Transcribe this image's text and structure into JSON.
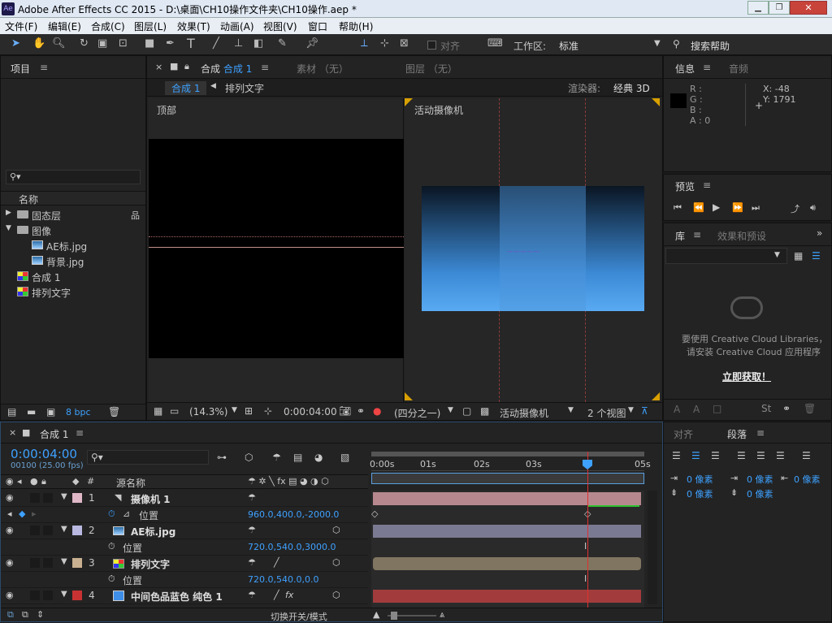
{
  "window": {
    "title": "Adobe After Effects CC 2015 - D:\\桌面\\CH10操作文件夹\\CH10操作.aep *",
    "app_icon": "Ae"
  },
  "menu": [
    "文件(F)",
    "编辑(E)",
    "合成(C)",
    "图层(L)",
    "效果(T)",
    "动画(A)",
    "视图(V)",
    "窗口",
    "帮助(H)"
  ],
  "toolbar": {
    "align_label": "对齐",
    "workspace_label": "工作区:",
    "workspace_value": "标准",
    "search_help": "搜索帮助"
  },
  "project": {
    "title": "项目",
    "col_name": "名称",
    "items": [
      {
        "label": "固态层",
        "type": "folder",
        "open": false
      },
      {
        "label": "图像",
        "type": "folder",
        "open": true
      },
      {
        "label": "AE标.jpg",
        "type": "image"
      },
      {
        "label": "背景.jpg",
        "type": "image"
      },
      {
        "label": "合成 1",
        "type": "comp"
      },
      {
        "label": "排列文字",
        "type": "comp"
      }
    ],
    "bpc": "8 bpc"
  },
  "composition": {
    "tab_label": "合成",
    "tab_name": "合成 1",
    "footage_tab": "素材 （无）",
    "layer_tab": "图层 （无）",
    "breadcrumb_active": "合成 1",
    "breadcrumb_next": "排列文字",
    "renderer_label": "渲染器:",
    "renderer_value": "经典 3D",
    "view_top": "顶部",
    "view_camera": "活动摄像机",
    "zoom": "(14.3%)",
    "timecode": "0:00:04:00",
    "resolution": "(四分之一)",
    "camera_select": "活动摄像机",
    "views_select": "2 个视图"
  },
  "info": {
    "title": "信息",
    "audio": "音频",
    "r": "R :",
    "g": "G :",
    "b": "B :",
    "a": "A : 0",
    "x": "X: -48",
    "y": "Y: 1791"
  },
  "preview": {
    "title": "预览"
  },
  "library": {
    "title": "库",
    "effects": "效果和预设",
    "message1": "要使用 Creative Cloud Libraries，",
    "message2": "请安装 Creative Cloud 应用程序",
    "link": "立即获取！"
  },
  "align_panel": {
    "title": "对齐",
    "para": "段落",
    "units": [
      "0 像素",
      "0 像素",
      "0 像素",
      "0 像素",
      "0 像素"
    ]
  },
  "timeline": {
    "tab": "合成 1",
    "timecode": "0:00:04:00",
    "frame_info": "00100 (25.00 fps)",
    "col_source": "源名称",
    "ruler": [
      "0:00s",
      "01s",
      "02s",
      "03s",
      "05s"
    ],
    "layers": [
      {
        "num": "1",
        "name": "摄像机 1",
        "color": "#e0b8c8",
        "prop": "位置",
        "value": "960.0,400.0,-2000.0",
        "bar": "#b7898f",
        "icon": "camera"
      },
      {
        "num": "2",
        "name": "AE标.jpg",
        "color": "#b8b8e0",
        "prop": "位置",
        "value": "720.0,540.0,3000.0",
        "bar": "#7a7a92",
        "icon": "image"
      },
      {
        "num": "3",
        "name": "排列文字",
        "color": "#c8b090",
        "prop": "位置",
        "value": "720.0,540.0,0.0",
        "bar": "#807560",
        "icon": "comp"
      },
      {
        "num": "4",
        "name": "中间色品蓝色 纯色 1",
        "color": "#c83232",
        "prop": "位置",
        "value": "",
        "bar": "#a23c3c",
        "icon": "solid"
      }
    ],
    "toggle_label": "切换开关/模式"
  }
}
